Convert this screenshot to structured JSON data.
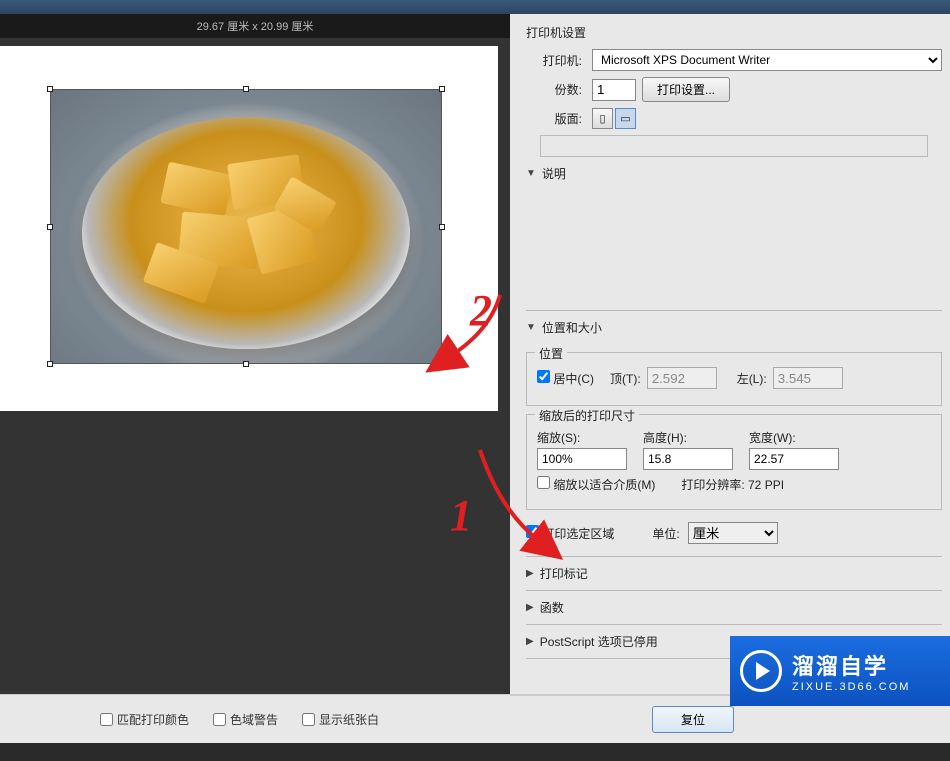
{
  "ruler": "29.67 厘米  x  20.99 厘米",
  "printer_settings": {
    "title": "打印机设置",
    "printer_label": "打印机:",
    "printer_value": "Microsoft XPS Document Writer",
    "copies_label": "份数:",
    "copies_value": "1",
    "print_setup_btn": "打印设置...",
    "layout_label": "版面:"
  },
  "description_header": "说明",
  "position_size": {
    "header": "位置和大小",
    "position_legend": "位置",
    "center_label": "居中(C)",
    "top_label": "顶(T):",
    "top_value": "2.592",
    "left_label": "左(L):",
    "left_value": "3.545",
    "scaled_legend": "缩放后的打印尺寸",
    "scale_label": "缩放(S):",
    "scale_value": "100%",
    "height_label": "高度(H):",
    "height_value": "15.8",
    "width_label": "宽度(W):",
    "width_value": "22.57",
    "fit_media_label": "缩放以适合介质(M)",
    "resolution_label": "打印分辨率: 72 PPI",
    "print_selected_label": "打印选定区域",
    "units_label": "单位:",
    "units_value": "厘米"
  },
  "collapsibles": {
    "print_marks": "打印标记",
    "functions": "函数",
    "postscript": "PostScript 选项已停用"
  },
  "bottom_checks": {
    "match_colors": "匹配打印颜色",
    "gamut_warn": "色域警告",
    "show_white": "显示纸张白"
  },
  "buttons": {
    "reset": "复位",
    "done_suffix": ")"
  },
  "logo": {
    "main": "溜溜自学",
    "sub": "ZIXUE.3D66.COM"
  },
  "annotations": {
    "num1": "1",
    "num2": "2"
  }
}
